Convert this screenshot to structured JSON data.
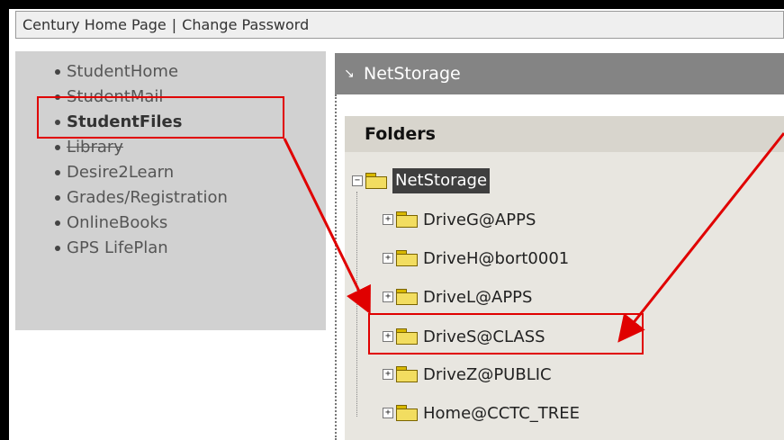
{
  "topbar": {
    "home_link": "Century Home Page",
    "separator": "|",
    "password_link": "Change Password"
  },
  "nav": {
    "items": [
      {
        "label": "StudentHome"
      },
      {
        "label": "StudentMail"
      },
      {
        "label": "StudentFiles"
      },
      {
        "label": "Library"
      },
      {
        "label": "Desire2Learn"
      },
      {
        "label": "Grades/Registration"
      },
      {
        "label": "OnlineBooks"
      },
      {
        "label": "GPS LifePlan"
      }
    ]
  },
  "netstorage": {
    "header_title": "NetStorage",
    "header_arrow": "↘",
    "folders_title": "Folders",
    "root": "NetStorage",
    "items": [
      "DriveG@APPS",
      "DriveH@bort0001",
      "DriveL@APPS",
      "DriveS@CLASS",
      "DriveZ@PUBLIC",
      "Home@CCTC_TREE"
    ]
  },
  "colors": {
    "annotation": "#e00000",
    "header_bg": "#848484",
    "left_panel_bg": "#d1d1d1"
  },
  "icons": {
    "expand": "plus-box",
    "collapse": "minus-box",
    "folder": "folder-icon"
  }
}
